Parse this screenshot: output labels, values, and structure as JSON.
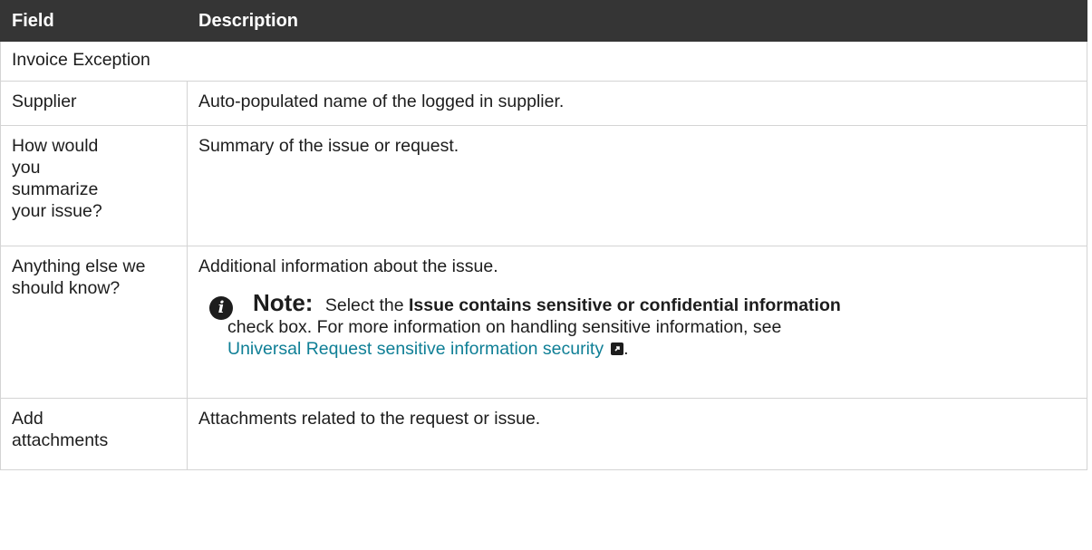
{
  "header": {
    "field": "Field",
    "description": "Description"
  },
  "section_title": "Invoice Exception",
  "rows": [
    {
      "field": "Supplier",
      "description": "Auto-populated name of the logged in supplier."
    },
    {
      "field": "How would you summarize your issue?",
      "description": "Summary of the issue or request."
    },
    {
      "field": "Anything else we should know?",
      "description": "Additional information about the issue."
    },
    {
      "field": "Add attachments",
      "description": "Attachments related to the request or issue."
    }
  ],
  "note": {
    "icon": "info-icon",
    "label": "Note:",
    "prefix": "Select the",
    "bold_text": "Issue contains sensitive or confidential information",
    "suffix": "check box. For more information on handling sensitive information, see",
    "link_text": "Universal Request sensitive information security",
    "link_icon": "external-link-icon",
    "end": ".",
    "link_color": "#0f7f96"
  }
}
